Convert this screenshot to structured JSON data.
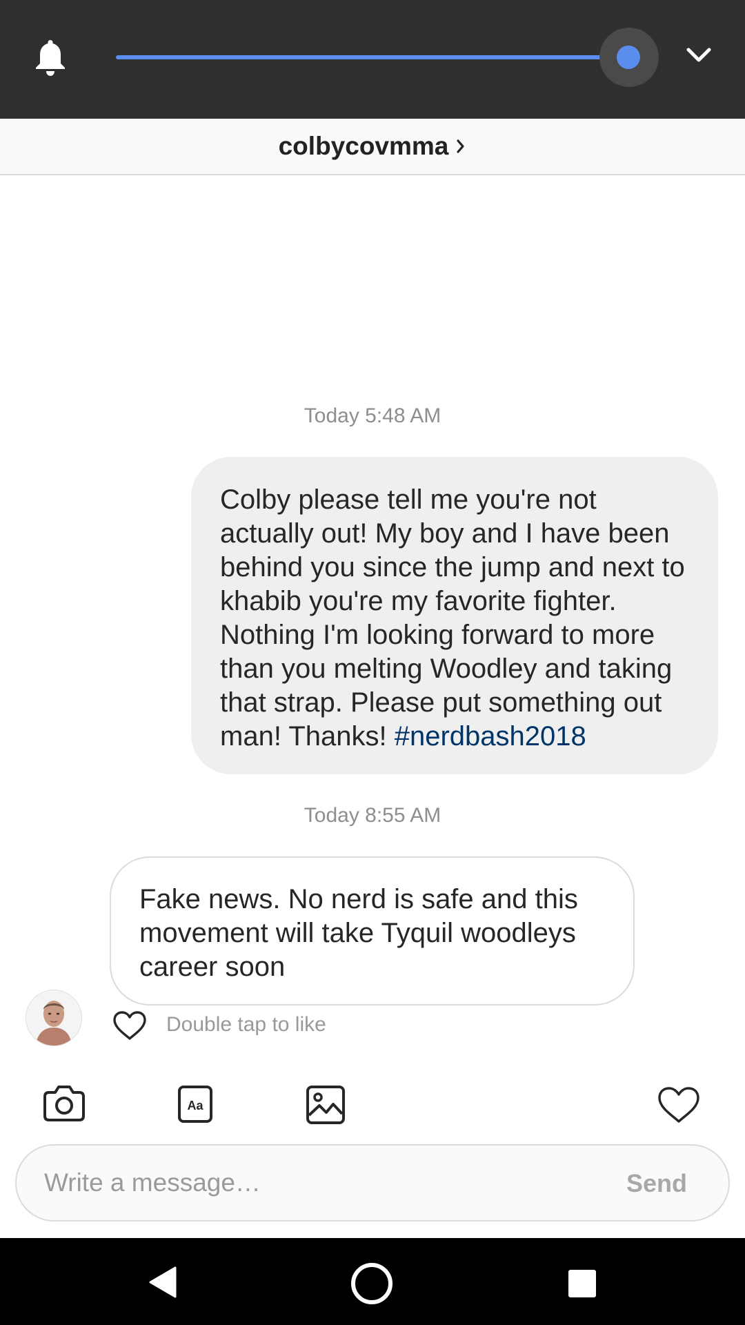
{
  "system_panel": {
    "brightness_percent": 100,
    "accent_color": "#5b8def"
  },
  "thread": {
    "username": "colbycovmma"
  },
  "messages": [
    {
      "timestamp": "Today 5:48 AM",
      "direction": "outgoing",
      "text": "Colby please tell me you're not actually out! My boy and I have been behind you since the jump and next to khabib you're my favorite fighter. Nothing I'm looking forward to more than you melting Woodley and taking that strap. Please put something out man! Thanks! ",
      "hashtag": "#nerdbash2018"
    },
    {
      "timestamp": "Today 8:55 AM",
      "direction": "incoming",
      "text": "Fake news. No nerd is safe and this movement will take Tyquil woodleys career soon",
      "like_hint": "Double tap to like"
    }
  ],
  "composer": {
    "tools": [
      "camera-icon",
      "text-icon",
      "gallery-icon",
      "heart-icon"
    ],
    "placeholder": "Write a message…",
    "send_label": "Send"
  },
  "nav": {
    "buttons": [
      "back",
      "home",
      "recents"
    ]
  }
}
